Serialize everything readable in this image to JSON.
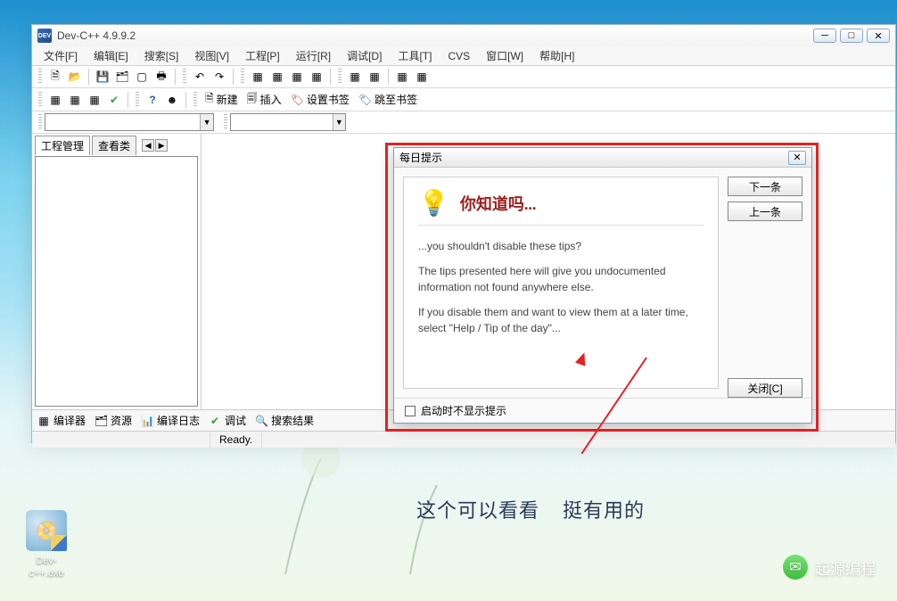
{
  "window": {
    "title": "Dev-C++ 4.9.9.2"
  },
  "menu": {
    "file": "文件[F]",
    "edit": "编辑[E]",
    "search": "搜索[S]",
    "view": "视图[V]",
    "project": "工程[P]",
    "run": "运行[R]",
    "debug": "调试[D]",
    "tools": "工具[T]",
    "cvs": "CVS",
    "window": "窗口[W]",
    "help": "帮助[H]"
  },
  "toolbar2": {
    "new": "新建",
    "insert": "插入",
    "bookmark_set": "设置书签",
    "bookmark_jump": "跳至书签"
  },
  "sidebar": {
    "tab_project": "工程管理",
    "tab_classes": "查看类"
  },
  "bottom_tabs": {
    "compiler": "编译器",
    "resources": "资源",
    "log": "编译日志",
    "debug": "调试",
    "search": "搜索结果"
  },
  "status": {
    "ready": "Ready."
  },
  "tip": {
    "title": "每日提示",
    "heading": "你知道吗...",
    "line1": "...you shouldn't disable these tips?",
    "line2": "The tips presented here will give you undocumented information not found anywhere else.",
    "line3": "If you disable them and want to view them at a later time, select \"Help / Tip of the day\"...",
    "btn_next": "下一条",
    "btn_prev": "上一条",
    "btn_close": "关闭[C]",
    "chk_label": "启动时不显示提示"
  },
  "annotation": {
    "text1": "这个可以看看",
    "text2": "挺有用的"
  },
  "desktop_icon": {
    "label": "Dev-c++.exe"
  },
  "watermark": {
    "text": "起源编程"
  }
}
